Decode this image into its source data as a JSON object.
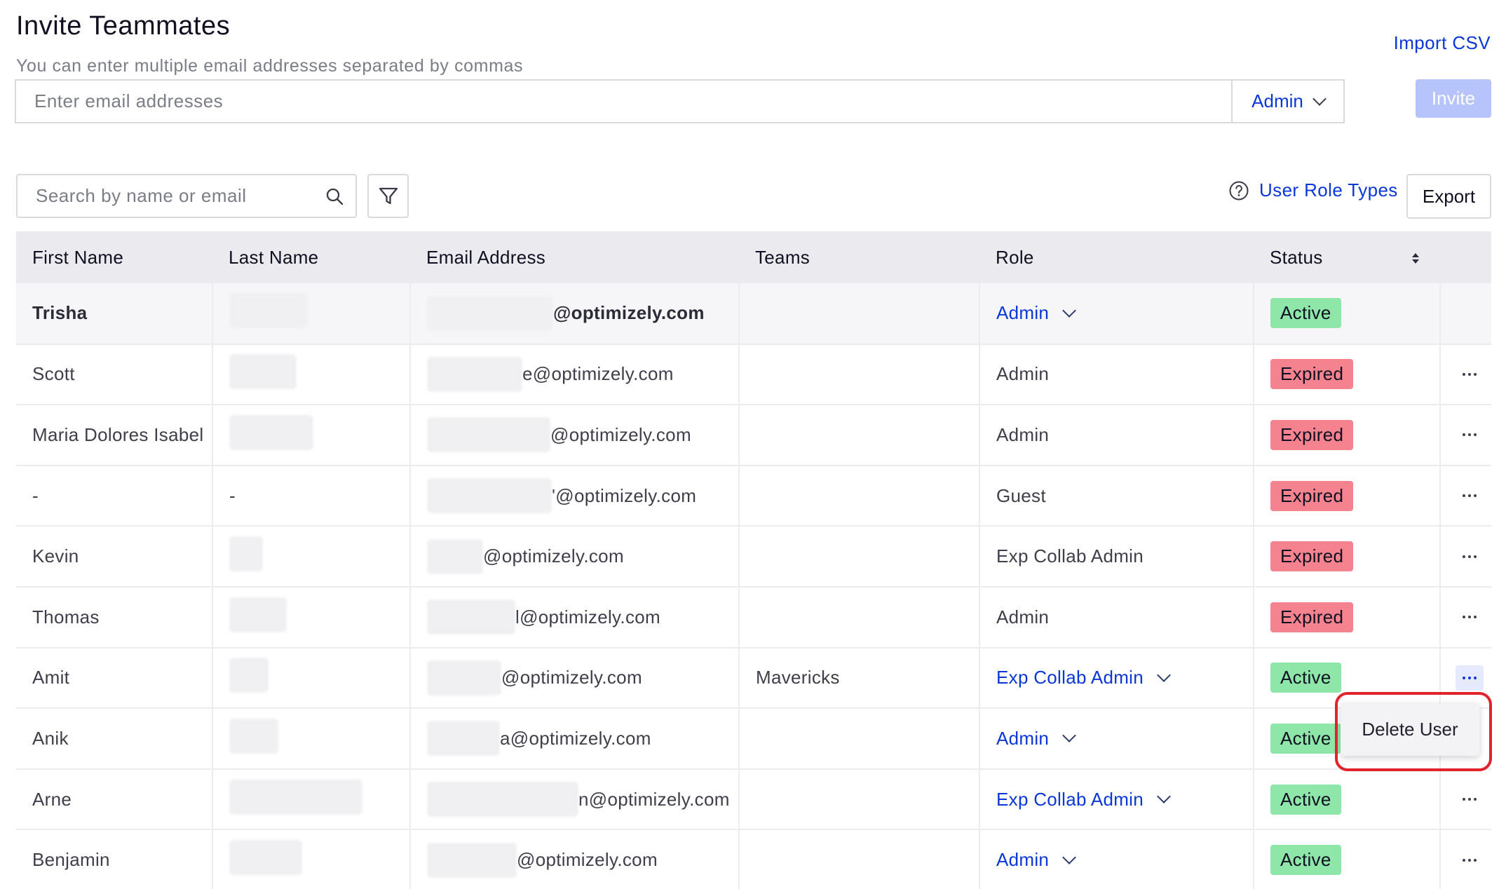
{
  "header": {
    "title": "Invite Teammates",
    "subtitle": "You can enter multiple email addresses separated by commas",
    "import_label": "Import CSV"
  },
  "invite": {
    "placeholder": "Enter email addresses",
    "role_value": "Admin",
    "invite_label": "Invite"
  },
  "toolbar": {
    "search_placeholder": "Search by name or email",
    "role_types_label": "User Role Types",
    "export_label": "Export"
  },
  "table": {
    "columns": [
      "First Name",
      "Last Name",
      "Email Address",
      "Teams",
      "Role",
      "Status"
    ],
    "rows": [
      {
        "first": "Trisha",
        "last": "",
        "email_domain": "@optimizely.com",
        "teams": "",
        "role": "Admin",
        "role_editable": true,
        "status": "Active"
      },
      {
        "first": "Scott",
        "last": "",
        "email_domain": "e@optimizely.com",
        "teams": "",
        "role": "Admin",
        "role_editable": false,
        "status": "Expired"
      },
      {
        "first": "Maria Dolores Isabel",
        "last": "",
        "email_domain": "@optimizely.com",
        "teams": "",
        "role": "Admin",
        "role_editable": false,
        "status": "Expired"
      },
      {
        "first": "-",
        "last": "-",
        "email_domain": "'@optimizely.com",
        "teams": "",
        "role": "Guest",
        "role_editable": false,
        "status": "Expired"
      },
      {
        "first": "Kevin",
        "last": "",
        "email_domain": "@optimizely.com",
        "teams": "",
        "role": "Exp Collab Admin",
        "role_editable": false,
        "status": "Expired"
      },
      {
        "first": "Thomas",
        "last": "",
        "email_domain": "l@optimizely.com",
        "teams": "",
        "role": "Admin",
        "role_editable": false,
        "status": "Expired"
      },
      {
        "first": "Amit",
        "last": "",
        "email_domain": "@optimizely.com",
        "teams": "Mavericks",
        "role": "Exp Collab Admin",
        "role_editable": true,
        "status": "Active"
      },
      {
        "first": "Anik",
        "last": "",
        "email_domain": "a@optimizely.com",
        "teams": "",
        "role": "Admin",
        "role_editable": true,
        "status": "Active"
      },
      {
        "first": "Arne",
        "last": "",
        "email_domain": "n@optimizely.com",
        "teams": "",
        "role": "Exp Collab Admin",
        "role_editable": true,
        "status": "Active"
      },
      {
        "first": "Benjamin",
        "last": "",
        "email_domain": "@optimizely.com",
        "teams": "",
        "role": "Admin",
        "role_editable": true,
        "status": "Active"
      }
    ]
  },
  "context_menu": {
    "delete_label": "Delete User"
  },
  "colors": {
    "accent": "#0a37d8",
    "active_badge": "#8ee6a9",
    "expired_badge": "#f5838f",
    "highlight": "#e3232c"
  }
}
